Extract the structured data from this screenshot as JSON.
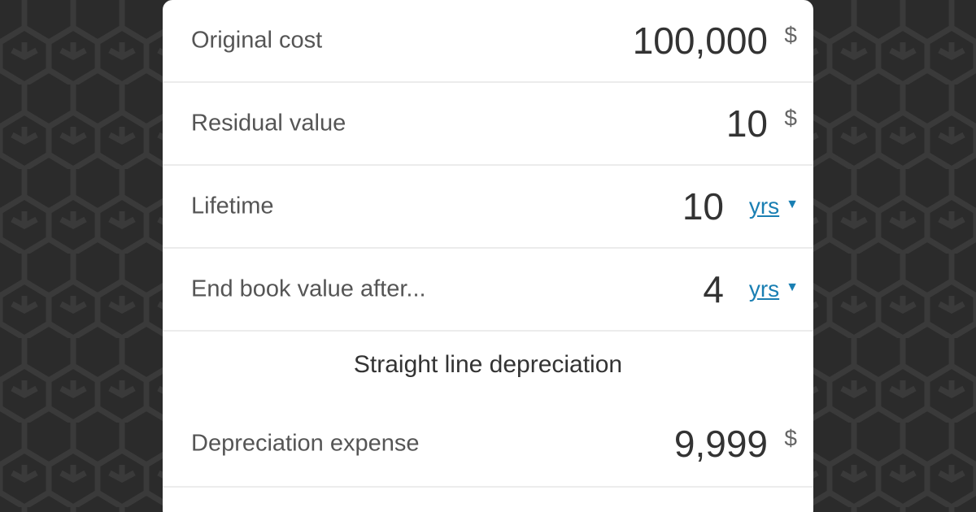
{
  "fields": [
    {
      "label": "Original cost",
      "value": "100,000",
      "unit": "$"
    },
    {
      "label": "Residual value",
      "value": "10",
      "unit": "$"
    },
    {
      "label": "Lifetime",
      "value": "10",
      "unit_link": "yrs"
    },
    {
      "label": "End book value after...",
      "value": "4",
      "unit_link": "yrs"
    }
  ],
  "section": {
    "title": "Straight line depreciation"
  },
  "result": {
    "label": "Depreciation expense",
    "value": "9,999",
    "unit": "$"
  },
  "colors": {
    "background": "#2b2b2b",
    "card": "#ffffff",
    "link": "#1a7fb3",
    "label": "#555555",
    "value": "#333333"
  },
  "icons": {
    "dropdown": "caret-down-icon"
  }
}
